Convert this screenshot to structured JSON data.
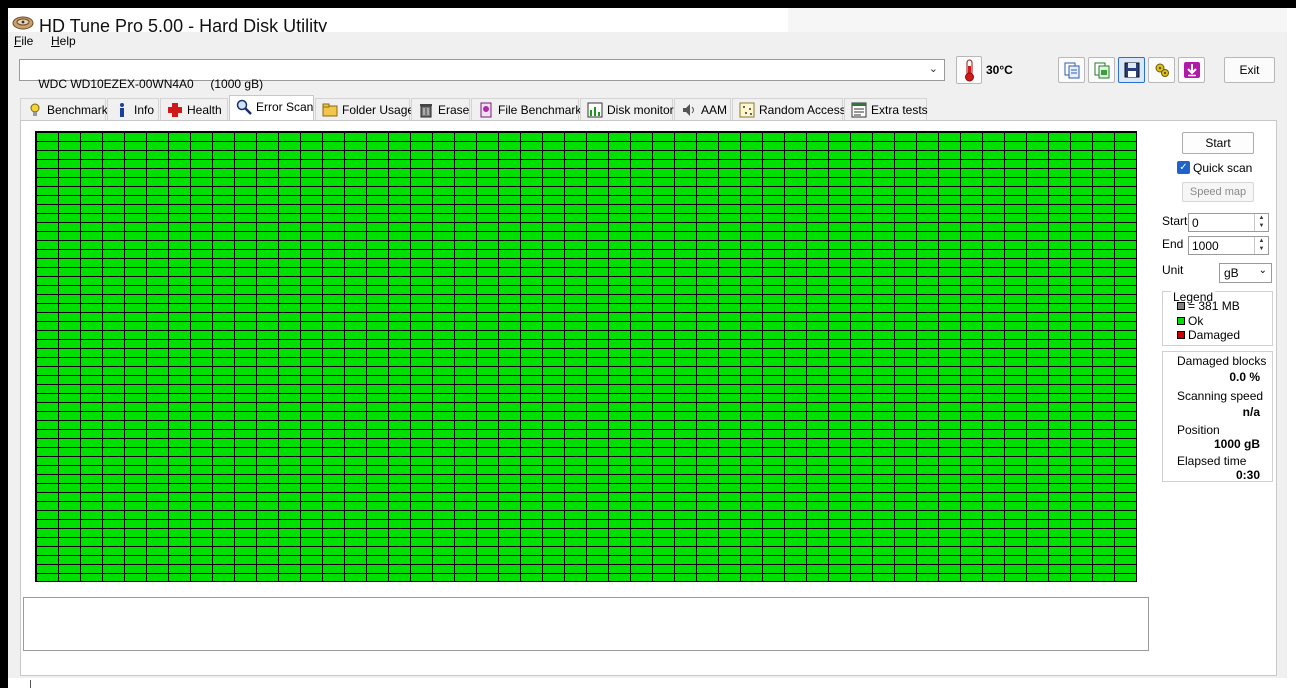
{
  "window": {
    "title": "HD Tune Pro 5.00 - Hard Disk Utility"
  },
  "menu": {
    "items": [
      {
        "label": "File",
        "accel": "F"
      },
      {
        "label": "Help",
        "accel": "H"
      }
    ]
  },
  "toolbar": {
    "drive": "WDC WD10EZEX-00WN4A0     (1000 gB)",
    "temperature": "30°C",
    "buttons": [
      "copy-info-icon",
      "copy-screenshot-icon",
      "save-icon",
      "options-icon",
      "download-icon"
    ],
    "exit_label": "Exit"
  },
  "tabs": [
    {
      "label": "Benchmark",
      "icon": "benchmark-icon"
    },
    {
      "label": "Info",
      "icon": "info-icon"
    },
    {
      "label": "Health",
      "icon": "health-icon"
    },
    {
      "label": "Error Scan",
      "icon": "error-scan-icon",
      "active": true
    },
    {
      "label": "Folder Usage",
      "icon": "folder-icon"
    },
    {
      "label": "Erase",
      "icon": "erase-icon"
    },
    {
      "label": "File Benchmark",
      "icon": "file-benchmark-icon"
    },
    {
      "label": "Disk monitor",
      "icon": "disk-monitor-icon"
    },
    {
      "label": "AAM",
      "icon": "aam-icon"
    },
    {
      "label": "Random Access",
      "icon": "random-access-icon"
    },
    {
      "label": "Extra tests",
      "icon": "extra-tests-icon"
    }
  ],
  "scan": {
    "block_status": "Ok",
    "colors": {
      "ok": "#00e000",
      "damaged": "#cc0000",
      "unit": "#808080",
      "grid": "#000000"
    }
  },
  "side": {
    "start_label": "Start",
    "quick_scan_label": "Quick scan",
    "quick_scan_checked": true,
    "speed_map_label": "Speed map",
    "start_field_label": "Start",
    "start_value": "0",
    "end_field_label": "End",
    "end_value": "1000",
    "unit_label": "Unit",
    "unit_value": "gB",
    "legend": {
      "title": "Legend",
      "items": [
        {
          "label": "= 381 MB",
          "color": "#808080"
        },
        {
          "label": "Ok",
          "color": "#00e000"
        },
        {
          "label": "Damaged",
          "color": "#cc0000"
        }
      ]
    },
    "stats": {
      "damaged_blocks_label": "Damaged blocks",
      "damaged_blocks_value": "0.0 %",
      "scanning_speed_label": "Scanning speed",
      "scanning_speed_value": "n/a",
      "position_label": "Position",
      "position_value": "1000 gB",
      "elapsed_label": "Elapsed time",
      "elapsed_value": "0:30"
    }
  }
}
